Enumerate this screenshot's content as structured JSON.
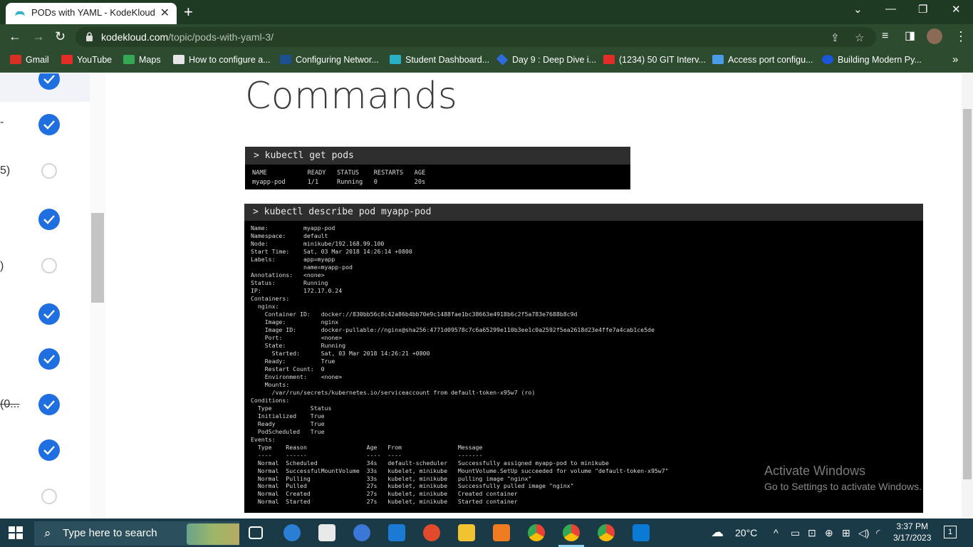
{
  "browser": {
    "tab": {
      "title": "PODs with YAML - KodeKloud",
      "close": "✕"
    },
    "new_tab": "+",
    "window_controls": {
      "chevron": "⌄",
      "minimize": "—",
      "restore": "❐",
      "close": "✕"
    },
    "url": {
      "domain": "kodekloud.com",
      "path": "/topic/pods-with-yaml-3/"
    },
    "bookmarks": [
      {
        "label": "Gmail",
        "icon": "gmail-icon",
        "color": "#d93025"
      },
      {
        "label": "YouTube",
        "icon": "youtube-icon",
        "color": "#e52d27"
      },
      {
        "label": "Maps",
        "icon": "maps-icon",
        "color": "#34a853"
      },
      {
        "label": "How to configure a...",
        "icon": "site-icon",
        "color": "#e6e6e6"
      },
      {
        "label": "Configuring Networ...",
        "icon": "vmware-icon",
        "color": "#1d4f91"
      },
      {
        "label": "Student Dashboard...",
        "icon": "kodekloud-icon",
        "color": "#2ab0c5"
      },
      {
        "label": "Day 9 : Deep Dive i...",
        "icon": "diamond-icon",
        "color": "#2f6be0"
      },
      {
        "label": "(1234) 50 GIT Interv...",
        "icon": "youtube-icon",
        "color": "#e52d27"
      },
      {
        "label": "Access port configu...",
        "icon": "link-icon",
        "color": "#4a9be8"
      },
      {
        "label": "Building Modern Py...",
        "icon": "c-icon",
        "color": "#1a56d8"
      }
    ],
    "bookmarks_more": "»"
  },
  "sidebar": {
    "fragments": [
      "-",
      "5)",
      ")",
      "(0..."
    ],
    "statuses": [
      "done",
      "done",
      "todo",
      "done",
      "todo",
      "done",
      "done",
      "done",
      "done",
      "todo"
    ]
  },
  "main": {
    "title": "Commands",
    "terminal1": {
      "command": "> kubectl get pods",
      "output": "NAME           READY   STATUS    RESTARTS   AGE\nmyapp-pod      1/1     Running   0          20s"
    },
    "terminal2": {
      "command": "> kubectl describe pod myapp-pod",
      "output": "Name:          myapp-pod\nNamespace:     default\nNode:          minikube/192.168.99.100\nStart Time:    Sat, 03 Mar 2018 14:26:14 +0800\nLabels:        app=myapp\n               name=myapp-pod\nAnnotations:   <none>\nStatus:        Running\nIP:            172.17.0.24\nContainers:\n  nginx:\n    Container ID:   docker://830bb56c8c42a86b4bb70e9c1488fae1bc38663e4918b6c2f5a783e7688b8c9d\n    Image:          nginx\n    Image ID:       docker-pullable://nginx@sha256:4771d09578c7c6a65299e110b3ee1c0a2592f5ea2618d23e4ffe7a4cab1ce5de\n    Port:           <none>\n    State:          Running\n      Started:      Sat, 03 Mar 2018 14:26:21 +0800\n    Ready:          True\n    Restart Count:  0\n    Environment:    <none>\n    Mounts:\n      /var/run/secrets/kubernetes.io/serviceaccount from default-token-x95w7 (ro)\nConditions:\n  Type           Status\n  Initialized    True\n  Ready          True\n  PodScheduled   True\nEvents:\n  Type    Reason                 Age   From                Message\n  ----    ------                 ----  ----                -------\n  Normal  Scheduled              34s   default-scheduler   Successfully assigned myapp-pod to minikube\n  Normal  SuccessfulMountVolume  33s   kubelet, minikube   MountVolume.SetUp succeeded for volume \"default-token-x95w7\"\n  Normal  Pulling                33s   kubelet, minikube   pulling image \"nginx\"\n  Normal  Pulled                 27s   kubelet, minikube   Successfully pulled image \"nginx\"\n  Normal  Created                27s   kubelet, minikube   Created container\n  Normal  Started                27s   kubelet, minikube   Started container"
    }
  },
  "watermark": {
    "line1": "Activate Windows",
    "line2": "Go to Settings to activate Windows."
  },
  "taskbar": {
    "search_placeholder": "Type here to search",
    "weather": "20°C",
    "time": "3:37 PM",
    "date": "3/17/2023",
    "notification_count": "1"
  }
}
